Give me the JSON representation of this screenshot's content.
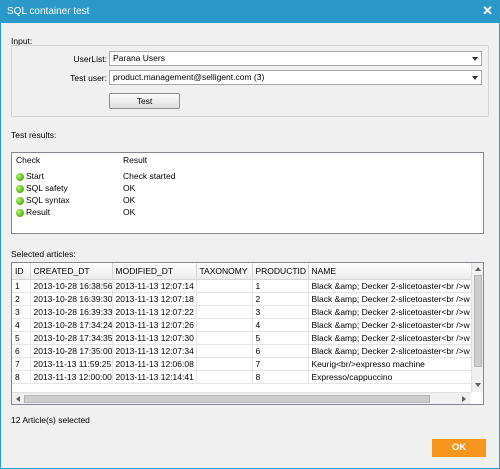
{
  "window": {
    "title": "SQL container test",
    "close_glyph": "✕"
  },
  "input": {
    "section_label": "Input:",
    "userlist_label": "UserList:",
    "userlist_value": "Parana Users",
    "testuser_label": "Test user:",
    "testuser_value": "product.management@selligent.com (3)",
    "test_button": "Test"
  },
  "results": {
    "section_label": "Test results:",
    "col_check": "Check",
    "col_result": "Result",
    "status_color": "#4fb412",
    "rows": [
      {
        "check": "Start",
        "result": "Check started"
      },
      {
        "check": "SQL safety",
        "result": "OK"
      },
      {
        "check": "SQL syntax",
        "result": "OK"
      },
      {
        "check": "Result",
        "result": "OK"
      }
    ]
  },
  "articles": {
    "section_label": "Selected articles:",
    "columns": [
      "ID",
      "CREATED_DT",
      "MODIFIED_DT",
      "TAXONOMY",
      "PRODUCTID",
      "NAME"
    ],
    "rows": [
      [
        "1",
        "2013-10-28 16:38:56",
        "2013-11-13 12:07:14",
        "",
        "1",
        "Black &amp; Decker 2-slicetoaster<br />w"
      ],
      [
        "2",
        "2013-10-28 16:39:30",
        "2013-11-13 12:07:18",
        "",
        "2",
        "Black &amp; Decker 2-slicetoaster<br />w"
      ],
      [
        "3",
        "2013-10-28 16:39:33",
        "2013-11-13 12:07:22",
        "",
        "3",
        "Black &amp; Decker 2-slicetoaster<br />w"
      ],
      [
        "4",
        "2013-10-28 17:34:24",
        "2013-11-13 12:07:26",
        "",
        "4",
        "Black &amp; Decker 2-slicetoaster<br />w"
      ],
      [
        "5",
        "2013-10-28 17:34:35",
        "2013-11-13 12:07:30",
        "",
        "5",
        "Black &amp; Decker 2-slicetoaster<br />w"
      ],
      [
        "6",
        "2013-10-28 17:35:00",
        "2013-11-13 12:07:34",
        "",
        "6",
        "Black &amp; Decker 2-slicetoaster<br />w"
      ],
      [
        "7",
        "2013-11-13 11:59:25",
        "2013-11-13 12:06:08",
        "",
        "7",
        "Keurig<br/>expresso machine"
      ],
      [
        "8",
        "2013-11-13 12:00:00",
        "2013-11-13 12:14:41",
        "",
        "8",
        "Expresso/cappuccino"
      ]
    ],
    "count_text": "12 Article(s) selected"
  },
  "footer": {
    "ok_button": "OK",
    "ok_color": "#f7961e"
  }
}
